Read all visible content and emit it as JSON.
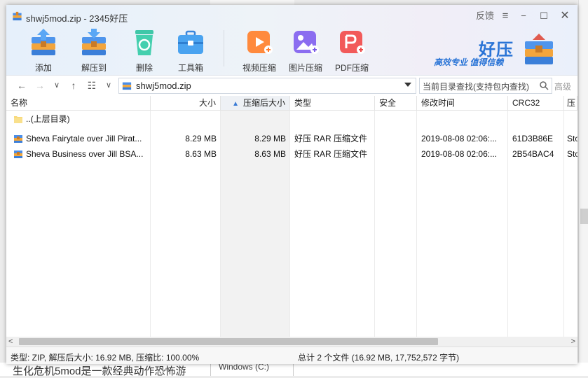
{
  "background": {
    "text": "生化危机5mod是一款经典动作恐怖游",
    "drive": "Windows (C:)"
  },
  "window": {
    "title": "shwj5mod.zip - 2345好压",
    "feedback": "反馈",
    "menu_icon": "≡",
    "minimize_icon": "−",
    "maximize_icon": "☐",
    "close_icon": "✕"
  },
  "toolbar": {
    "items": [
      {
        "label": "添加",
        "icon": "add-archive-icon"
      },
      {
        "label": "解压到",
        "icon": "extract-to-icon"
      },
      {
        "label": "删除",
        "icon": "recycle-icon"
      },
      {
        "label": "工具箱",
        "icon": "toolbox-icon"
      },
      {
        "label": "视频压缩",
        "icon": "video-compress-icon"
      },
      {
        "label": "图片压缩",
        "icon": "image-compress-icon"
      },
      {
        "label": "PDF压缩",
        "icon": "pdf-compress-icon"
      }
    ]
  },
  "brand": {
    "name": "好压",
    "slogan": "高效专业  值得信赖"
  },
  "nav": {
    "path": "shwj5mod.zip",
    "search_placeholder": "当前目录查找(支持包内查找)",
    "advanced": "高级"
  },
  "table": {
    "headers": {
      "name": "名称",
      "size": "大小",
      "packed": "压缩后大小",
      "type": "类型",
      "security": "安全",
      "modified": "修改时间",
      "crc": "CRC32",
      "method": "压"
    },
    "parent": "..(上层目录)",
    "rows": [
      {
        "name": "Sheva Fairytale over Jill Pirat...",
        "size": "8.29 MB",
        "packed": "8.29 MB",
        "type": "好压 RAR 压缩文件",
        "security": "",
        "modified": "2019-08-08 02:06:...",
        "crc": "61D3B86E",
        "method": "Sto"
      },
      {
        "name": "Sheva Business over Jill BSA...",
        "size": "8.63 MB",
        "packed": "8.63 MB",
        "type": "好压 RAR 压缩文件",
        "security": "",
        "modified": "2019-08-08 02:06:...",
        "crc": "2B54BAC4",
        "method": "Sto"
      }
    ]
  },
  "status": {
    "left": "类型: ZIP, 解压后大小: 16.92 MB, 压缩比: 100.00%",
    "right": "总计 2 个文件 (16.92 MB, 17,752,572 字节)"
  },
  "colors": {
    "accent": "#2a74d6",
    "header_bg": "#eaf1fb"
  }
}
